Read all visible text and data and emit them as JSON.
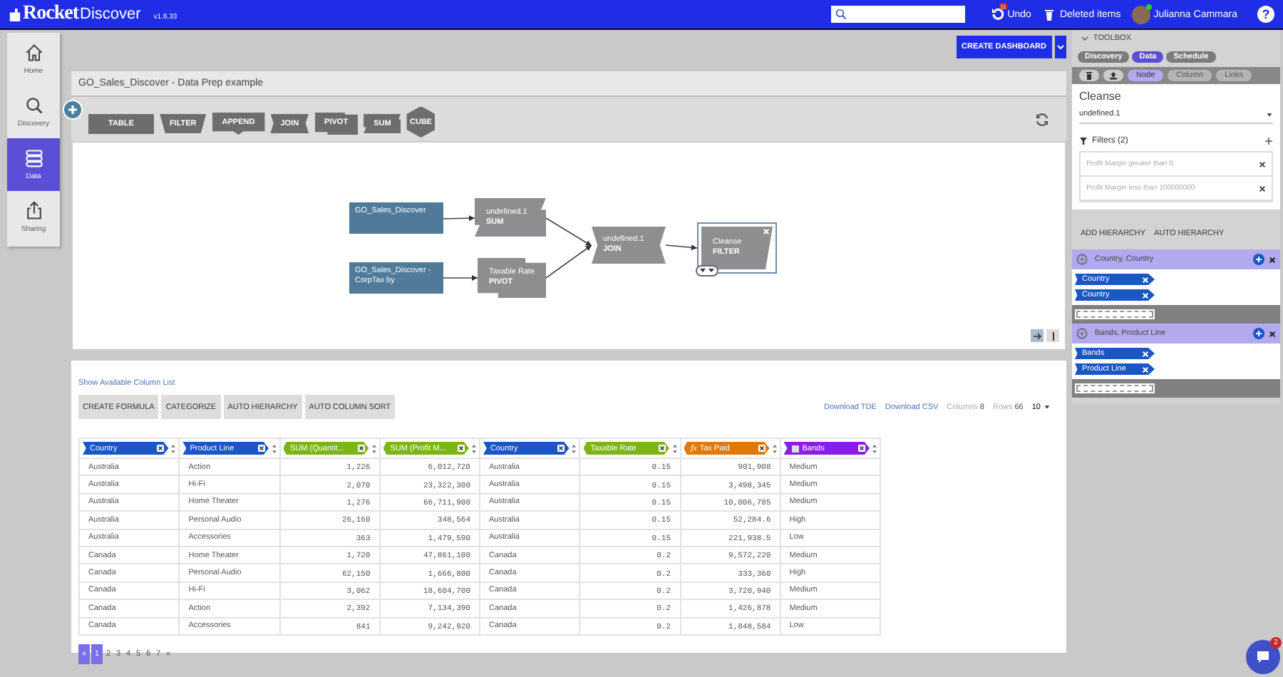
{
  "app": {
    "logo": "Rocket",
    "logo_suffix": "Discover",
    "version": "v1.6.33"
  },
  "topbar": {
    "undo": {
      "label": "Undo",
      "badge": "11"
    },
    "deleted": "Deleted items",
    "user": {
      "name": "Julianna Cammara",
      "online": true
    },
    "help": "?"
  },
  "nav": [
    {
      "kind": "home",
      "label": "Home",
      "selected": false
    },
    {
      "kind": "discovery",
      "label": "Discovery",
      "selected": false
    },
    {
      "kind": "data",
      "label": "Data",
      "selected": true
    },
    {
      "kind": "sharing",
      "label": "Sharing",
      "selected": false
    }
  ],
  "create_dashboard": "CREATE DASHBOARD",
  "title": "GO_Sales_Discover - Data Prep example",
  "palette": [
    {
      "kind": "table",
      "label": "TABLE"
    },
    {
      "kind": "filter",
      "label": "FILTER"
    },
    {
      "kind": "append",
      "label": "APPEND"
    },
    {
      "kind": "join",
      "label": "JOIN"
    },
    {
      "kind": "pivot",
      "label": "PIVOT"
    },
    {
      "kind": "sum",
      "label": "SUM"
    },
    {
      "kind": "cube",
      "label": "CUBE"
    }
  ],
  "diagram": {
    "nodes": [
      {
        "kind": "source",
        "label": "GO_Sales_Discover",
        "selected": false
      },
      {
        "kind": "source",
        "label": "GO_Sales_Discover - CorpTax by",
        "selected": false
      },
      {
        "kind": "sum",
        "name": "undefined.1",
        "op": "SUM",
        "selected": false
      },
      {
        "kind": "pivot",
        "name": "Taxable Rate",
        "op": "PIVOT",
        "selected": false
      },
      {
        "kind": "join",
        "name": "undefined.1",
        "op": "JOIN",
        "selected": false
      },
      {
        "kind": "filter",
        "name": "Cleanse",
        "op": "FILTER",
        "selected": true
      }
    ]
  },
  "table_panel": {
    "show_columns": "Show Available Column List",
    "actions": [
      "CREATE FORMULA",
      "CATEGORIZE",
      "AUTO HIERARCHY",
      "AUTO COLUMN SORT"
    ],
    "downloads": [
      "Download TDE",
      "Download CSV"
    ],
    "columns_label": "Columns",
    "columns_count": "8",
    "rows_label": "Rows",
    "rows_count": "66",
    "page_size": "10",
    "columns": [
      {
        "kind": "dimension",
        "label": "Country"
      },
      {
        "kind": "dimension",
        "label": "Product Line"
      },
      {
        "kind": "measure",
        "label": "SUM (Quantit..."
      },
      {
        "kind": "measure",
        "label": "SUM (Profit M..."
      },
      {
        "kind": "dimension",
        "label": "Country"
      },
      {
        "kind": "measure",
        "label": "Taxable Rate"
      },
      {
        "kind": "calculated",
        "prefix": "fx",
        "label": "Tax Paid"
      },
      {
        "kind": "band",
        "label": "Bands"
      }
    ],
    "rows": [
      [
        "Australia",
        "Action",
        "1,226",
        "6,012,720",
        "Australia",
        "0.15",
        "901,908",
        "Medium"
      ],
      [
        "Australia",
        "Hi-Fi",
        "2,070",
        "23,322,300",
        "Australia",
        "0.15",
        "3,498,345",
        "Medium"
      ],
      [
        "Australia",
        "Home Theater",
        "1,276",
        "66,711,900",
        "Australia",
        "0.15",
        "10,006,785",
        "Medium"
      ],
      [
        "Australia",
        "Personal Audio",
        "26,160",
        "348,564",
        "Australia",
        "0.15",
        "52,284.6",
        "High"
      ],
      [
        "Australia",
        "Accessories",
        "363",
        "1,479,590",
        "Australia",
        "0.15",
        "221,938.5",
        "Low"
      ],
      [
        "Canada",
        "Home Theater",
        "1,720",
        "47,861,100",
        "Canada",
        "0.2",
        "9,572,220",
        "Medium"
      ],
      [
        "Canada",
        "Personal Audio",
        "62,150",
        "1,666,800",
        "Canada",
        "0.2",
        "333,360",
        "High"
      ],
      [
        "Canada",
        "Hi-Fi",
        "3,062",
        "18,604,700",
        "Canada",
        "0.2",
        "3,720,940",
        "Medium"
      ],
      [
        "Canada",
        "Action",
        "2,392",
        "7,134,390",
        "Canada",
        "0.2",
        "1,426,878",
        "Medium"
      ],
      [
        "Canada",
        "Accessories",
        "841",
        "9,242,920",
        "Canada",
        "0.2",
        "1,848,584",
        "Low"
      ]
    ],
    "pagination": {
      "prev": "«",
      "pages": [
        {
          "label": "1",
          "selected": true
        },
        {
          "label": "2",
          "selected": false
        },
        {
          "label": "3",
          "selected": false
        },
        {
          "label": "4",
          "selected": false
        },
        {
          "label": "5",
          "selected": false
        },
        {
          "label": "6",
          "selected": false
        },
        {
          "label": "7",
          "selected": false
        }
      ],
      "next": "»"
    }
  },
  "toolbox": {
    "title": "TOOLBOX",
    "tabs": [
      {
        "label": "Discovery",
        "selected": false
      },
      {
        "label": "Data",
        "selected": true
      },
      {
        "label": "Schedule",
        "selected": false
      }
    ],
    "modes": [
      {
        "label": "Node",
        "selected": true,
        "disabled": false
      },
      {
        "label": "Column",
        "selected": false,
        "disabled": true
      },
      {
        "label": "Links",
        "selected": false,
        "disabled": true
      }
    ],
    "node_title": "Cleanse",
    "node_select": "undefined.1",
    "filters_title": "Filters (2)",
    "filters": [
      "Profit Margin greater than 0",
      "Profit Margin less than 100000000"
    ],
    "hierarchy_actions": [
      "ADD HIERARCHY",
      "AUTO HIERARCHY"
    ],
    "hierarchies": [
      {
        "title": "Country, Country",
        "items": [
          "Country",
          "Country"
        ]
      },
      {
        "title": "Bands, Product Line",
        "items": [
          "Bands",
          "Product Line"
        ]
      }
    ]
  },
  "chat": {
    "badge": "2"
  }
}
